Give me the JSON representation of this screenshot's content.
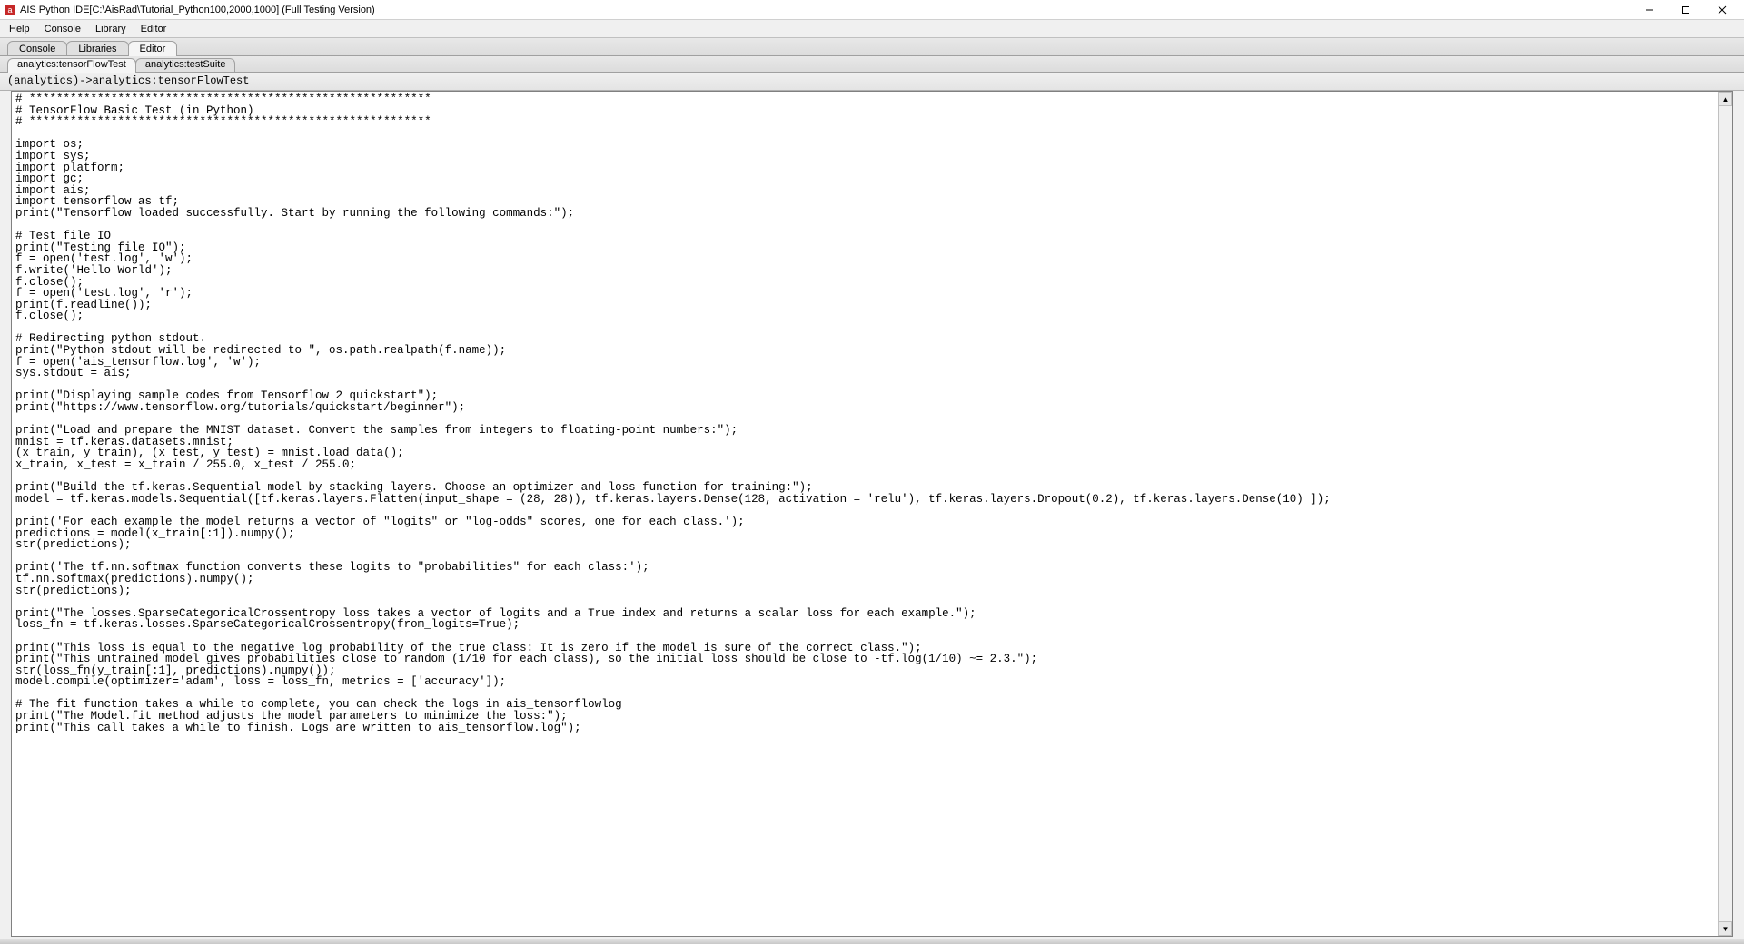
{
  "window": {
    "title": "AIS Python IDE[C:\\AisRad\\Tutorial_Python100,2000,1000] (Full Testing Version)"
  },
  "menubar": {
    "items": [
      "Help",
      "Console",
      "Library",
      "Editor"
    ]
  },
  "mainTabs": {
    "items": [
      "Console",
      "Libraries",
      "Editor"
    ],
    "activeIndex": 2
  },
  "fileTabs": {
    "items": [
      "analytics:tensorFlowTest",
      "analytics:testSuite"
    ],
    "activeIndex": 0
  },
  "breadcrumb": "(analytics)->analytics:tensorFlowTest",
  "editor": {
    "code": "# ***********************************************************\n# TensorFlow Basic Test (in Python)\n# ***********************************************************\n\nimport os;\nimport sys;\nimport platform;\nimport gc;\nimport ais;\nimport tensorflow as tf;\nprint(\"Tensorflow loaded successfully. Start by running the following commands:\");\n\n# Test file IO\nprint(\"Testing file IO\");\nf = open('test.log', 'w');\nf.write('Hello World');\nf.close();\nf = open('test.log', 'r');\nprint(f.readline());\nf.close();\n\n# Redirecting python stdout.\nprint(\"Python stdout will be redirected to \", os.path.realpath(f.name));\nf = open('ais_tensorflow.log', 'w');\nsys.stdout = ais;\n\nprint(\"Displaying sample codes from Tensorflow 2 quickstart\");\nprint(\"https://www.tensorflow.org/tutorials/quickstart/beginner\");\n\nprint(\"Load and prepare the MNIST dataset. Convert the samples from integers to floating-point numbers:\");\nmnist = tf.keras.datasets.mnist;\n(x_train, y_train), (x_test, y_test) = mnist.load_data();\nx_train, x_test = x_train / 255.0, x_test / 255.0;\n\nprint(\"Build the tf.keras.Sequential model by stacking layers. Choose an optimizer and loss function for training:\");\nmodel = tf.keras.models.Sequential([tf.keras.layers.Flatten(input_shape = (28, 28)), tf.keras.layers.Dense(128, activation = 'relu'), tf.keras.layers.Dropout(0.2), tf.keras.layers.Dense(10) ]);\n\nprint('For each example the model returns a vector of \"logits\" or \"log-odds\" scores, one for each class.');\npredictions = model(x_train[:1]).numpy();\nstr(predictions);\n\nprint('The tf.nn.softmax function converts these logits to \"probabilities\" for each class:');\ntf.nn.softmax(predictions).numpy();\nstr(predictions);\n\nprint(\"The losses.SparseCategoricalCrossentropy loss takes a vector of logits and a True index and returns a scalar loss for each example.\");\nloss_fn = tf.keras.losses.SparseCategoricalCrossentropy(from_logits=True);\n\nprint(\"This loss is equal to the negative log probability of the true class: It is zero if the model is sure of the correct class.\");\nprint(\"This untrained model gives probabilities close to random (1/10 for each class), so the initial loss should be close to -tf.log(1/10) ~= 2.3.\");\nstr(loss_fn(y_train[:1], predictions).numpy());\nmodel.compile(optimizer='adam', loss = loss_fn, metrics = ['accuracy']);\n\n# The fit function takes a while to complete, you can check the logs in ais_tensorflowlog\nprint(\"The Model.fit method adjusts the model parameters to minimize the loss:\");\nprint(\"This call takes a while to finish. Logs are written to ais_tensorflow.log\");"
  }
}
